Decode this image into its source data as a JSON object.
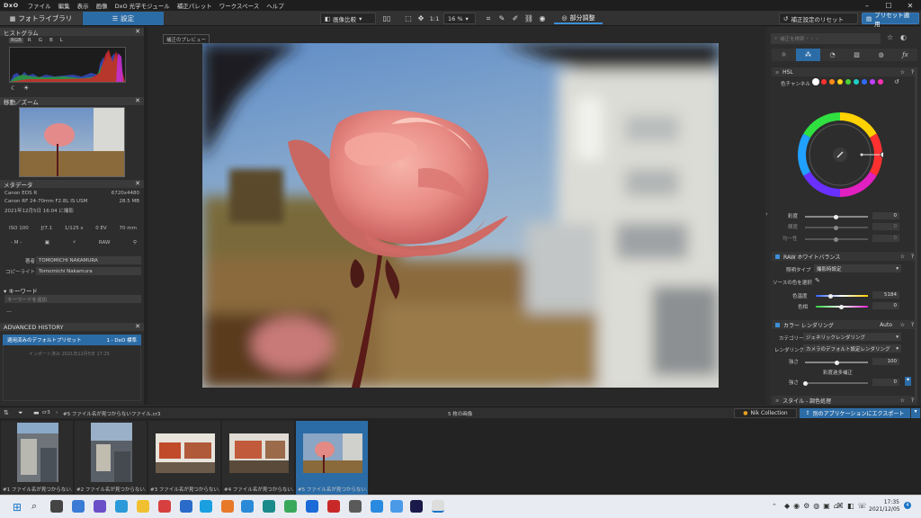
{
  "menubar": {
    "logo": "DxO",
    "items": [
      "ファイル",
      "編集",
      "表示",
      "画像",
      "DxO 光学モジュール",
      "補正パレット",
      "ワークスペース",
      "ヘルプ"
    ]
  },
  "toolbar": {
    "library_tab": "フォトライブラリ",
    "customize_tab": "設定",
    "compare": "画像比較",
    "zoom_ratio": "1:1",
    "zoom_percent": "16 %",
    "local_adjust": "部分調整",
    "reset": "補正設定のリセット",
    "apply_preset": "プリセット適用"
  },
  "left": {
    "histogram_title": "ヒストグラム",
    "histo_channels": [
      "RGB",
      "R",
      "G",
      "B",
      "L"
    ],
    "navigator_title": "移動／ズーム",
    "metadata_title": "メタデータ",
    "camera": "Canon EOS R",
    "resolution": "6720x4480",
    "lens": "Canon RF 24-70mm F2.8L IS USM",
    "filesize": "28.5 MB",
    "date": "2021年12月5日 16:04 に撮影",
    "exif": [
      "ISO 100",
      "ƒ/7.1",
      "1/125 s",
      "0 EV",
      "70 mm"
    ],
    "mode": "- M -",
    "format": "RAW",
    "author_label": "著者",
    "author": "TOMOMICHI NAKAMURA",
    "copyright_label": "コピーライト",
    "copyright": "Tomomichi Nakamura",
    "keyword_title": "キーワード",
    "keyword_placeholder": "キーワードを追加",
    "keyword_dash": "—",
    "history_title": "ADVANCED HISTORY",
    "history_item": "適用済みのデフォルトプリセット",
    "history_item_value": "1 - DxO 標準",
    "history_sub": "インポート済み 2021年12月5日 17:25"
  },
  "center": {
    "preview_label": "補正のプレビュー"
  },
  "right": {
    "search_placeholder": "補正を検索・・・",
    "hsl_title": "HSL",
    "color_channel_label": "色チャンネル",
    "channel_colors": [
      "#ffffff",
      "#ff3030",
      "#ff8a1a",
      "#ffd21a",
      "#4cd23a",
      "#20d0c8",
      "#2f6bff",
      "#c040ff",
      "#ff30b0"
    ],
    "saturation_label": "彩度",
    "saturation_value": "0",
    "luminance_label": "輝度",
    "luminance_value": "0",
    "uniformity_label": "均一性",
    "uniformity_value": "0",
    "wb_title": "RAW ホワイトバランス",
    "preset_type_label": "照明タイプ",
    "preset_type_value": "撮影時設定",
    "pick_source": "ソースの色を選択",
    "temp_label": "色温度",
    "temp_value": "5184",
    "tint_label": "色相",
    "tint_value": "0",
    "rendering_title": "カラー レンダリング",
    "rendering_auto": "Auto",
    "category_label": "カテゴリー",
    "category_value": "ジェネリックレンダリング",
    "rendering_label": "レンダリング",
    "rendering_value": "カメラのデフォルト設定レンダリング",
    "intensity_label": "強さ",
    "intensity_value": "100",
    "protect_sat_label": "彩度過多補正",
    "intensity2_label": "強さ",
    "intensity2_value": "0",
    "style_title": "スタイル - 調色処理"
  },
  "filmstrip": {
    "folder": "cr3",
    "missing": "#5 ファイル名が見つからないファイル.cr3",
    "count": "5 枚の画像",
    "nik": "Nik Collection",
    "export": "別のアプリケーションにエクスポート",
    "thumbs": [
      "#1 ファイル名が見つからない...",
      "#2 ファイル名が見つからない...",
      "#3 ファイル名が見つからない...",
      "#4 ファイル名が見つからない...",
      "#5 ファイル名が見つからない..."
    ]
  },
  "taskbar": {
    "time": "17:35",
    "date": "2021/12/05"
  }
}
